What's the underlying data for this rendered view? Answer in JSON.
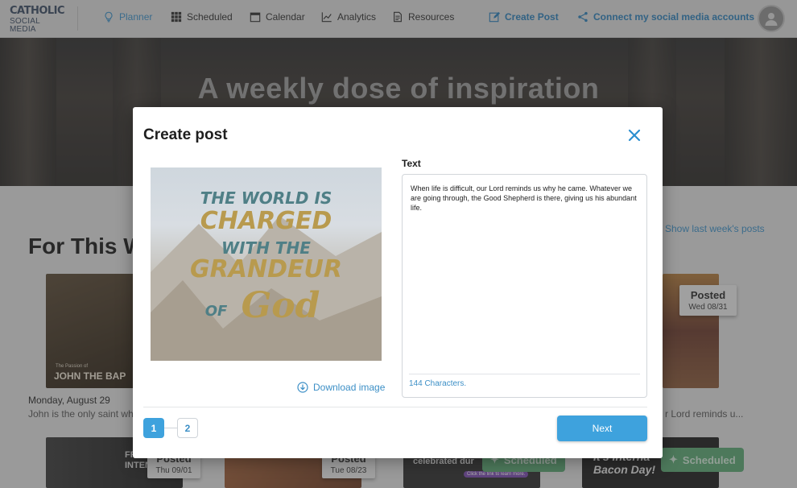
{
  "nav": {
    "logo_line1": "CATHOLIC",
    "logo_line2": "SOCIAL MEDIA",
    "items": [
      {
        "label": "Planner",
        "icon": "lightbulb-icon"
      },
      {
        "label": "Scheduled",
        "icon": "grid-icon"
      },
      {
        "label": "Calendar",
        "icon": "calendar-icon"
      },
      {
        "label": "Analytics",
        "icon": "chart-icon"
      },
      {
        "label": "Resources",
        "icon": "document-icon"
      }
    ],
    "create_post": "Create Post",
    "connect": "Connect my social media accounts"
  },
  "hero": {
    "title": "A weekly dose of inspiration"
  },
  "page": {
    "section_title": "For This W",
    "show_last_week": "Show last week's posts",
    "card1_title_small": "The Passion of",
    "card1_title": "JOHN THE BAP",
    "card1_date": "Monday, August 29",
    "card1_desc": "John is the only saint who",
    "card_right_desc": "r Lord reminds u...",
    "badges": [
      {
        "status": "Posted",
        "date": "Wed 08/31"
      },
      {
        "status": "Posted",
        "date": "Thu 09/01"
      },
      {
        "status": "Posted",
        "date": "Tue 08/23"
      }
    ],
    "scheduled_label": "Scheduled",
    "card_bottom_left_text": "FRA PRI INTENTION",
    "card_bottom_mid_text": "celebrated dur",
    "card_bottom_mid_link": "Click the link to learn more.",
    "card_bottom_right_text": "It's Interna Bacon Day!"
  },
  "modal": {
    "title": "Create post",
    "preview_lines": [
      "THE WORLD IS",
      "CHARGED",
      "WITH THE",
      "GRANDEUR",
      "OF",
      "God"
    ],
    "download_label": "Download image",
    "text_label": "Text",
    "text_value": "When life is difficult, our Lord reminds us why he came. Whatever we are going through, the Good Shepherd is there, giving us his abundant life.",
    "char_count": "144 Characters.",
    "steps": [
      "1",
      "2"
    ],
    "next_label": "Next"
  },
  "colors": {
    "accent": "#3ea2dd",
    "link": "#3c8fc6",
    "scheduled_green": "#5aa673",
    "preview_teal": "#4f7f86",
    "preview_gold": "#b89a4e"
  }
}
